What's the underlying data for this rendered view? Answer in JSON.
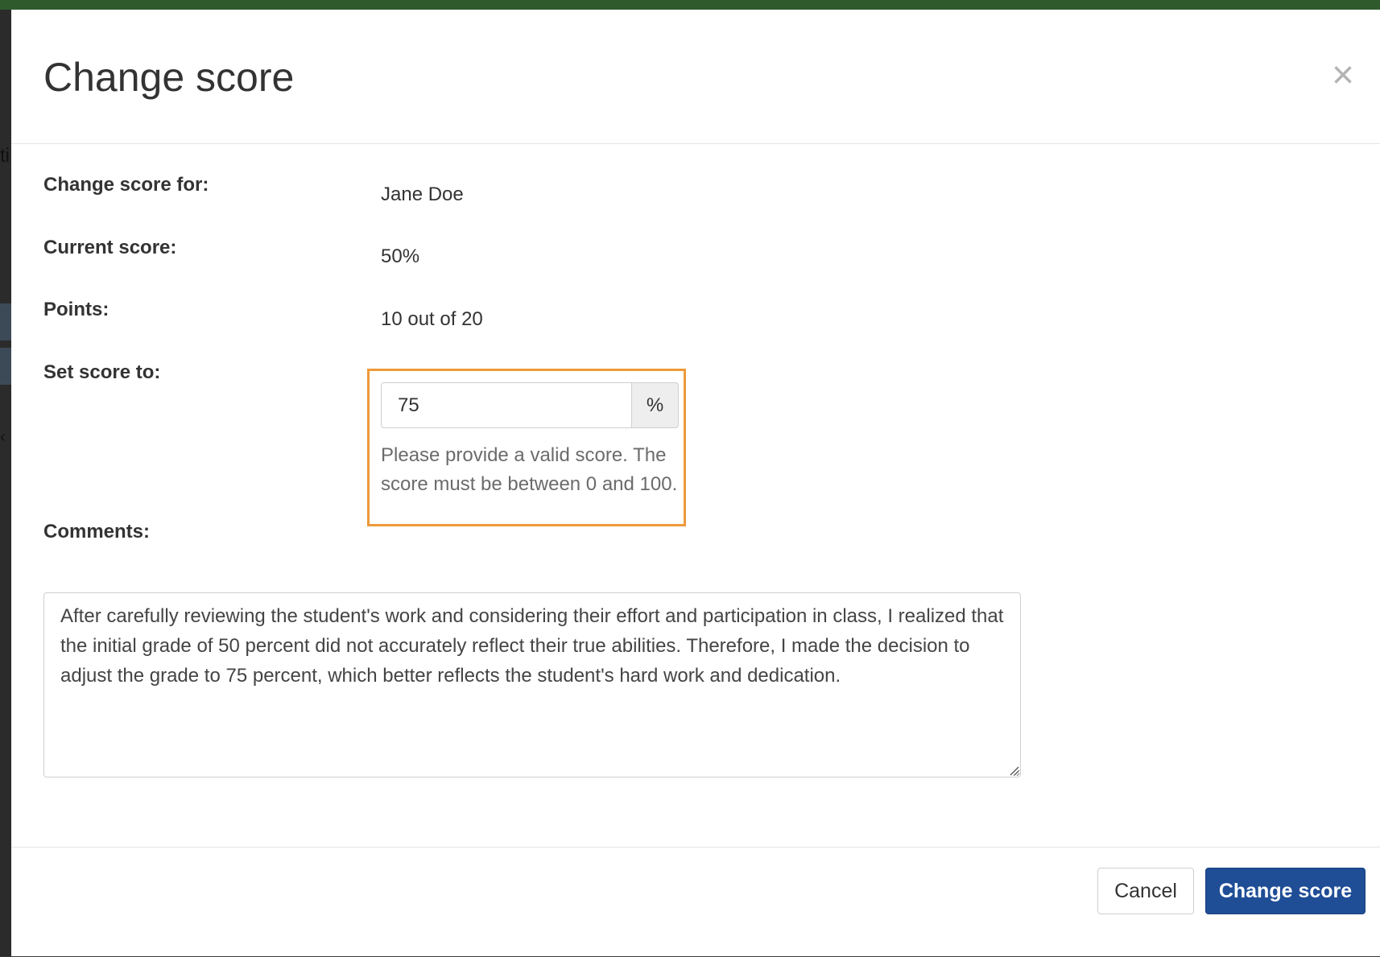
{
  "backdrop": {
    "partial_text": "ti",
    "chevron": "‹"
  },
  "modal": {
    "title": "Change score",
    "close_icon": "×",
    "fields": {
      "student_label": "Change score for:",
      "student_value": "Jane Doe",
      "current_label": "Current score:",
      "current_value": "50%",
      "points_label": "Points:",
      "points_value": "10 out of 20",
      "set_label": "Set score to:",
      "set_value": "75",
      "set_unit": "%",
      "help_text": "Please provide a valid score. The score must be between 0 and 100."
    },
    "comments": {
      "label": "Comments:",
      "value": "After carefully reviewing the student's work and considering their effort and participation in class, I realized that the initial grade of 50 percent did not accurately reflect their true abilities. Therefore, I made the decision to adjust the grade to 75 percent, which better reflects the student's hard work and dedication."
    },
    "footer": {
      "cancel_label": "Cancel",
      "submit_label": "Change score"
    }
  },
  "colors": {
    "primary": "#1f4d96",
    "highlight": "#ee9a3a",
    "backdrop_top": "#2f5a2c"
  }
}
